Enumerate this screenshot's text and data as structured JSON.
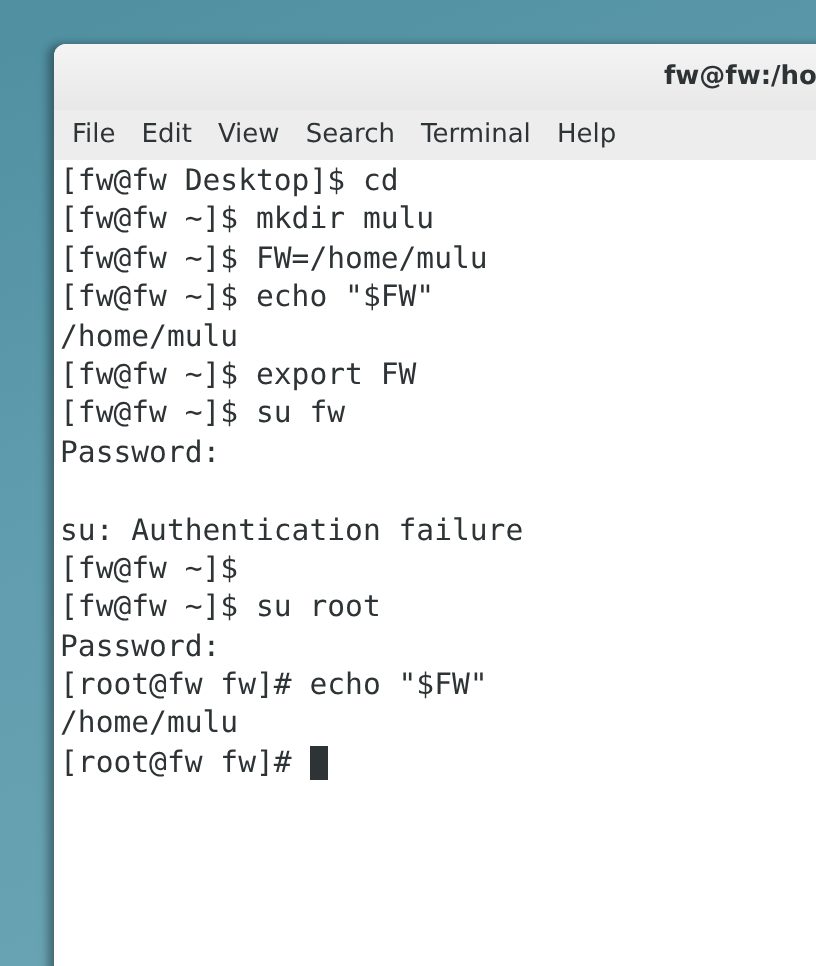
{
  "window": {
    "title": "fw@fw:/ho"
  },
  "menu": [
    "File",
    "Edit",
    "View",
    "Search",
    "Terminal",
    "Help"
  ],
  "terminal": {
    "lines": [
      {
        "kind": "text",
        "text": "[fw@fw Desktop]$ cd"
      },
      {
        "kind": "text",
        "text": "[fw@fw ~]$ mkdir mulu"
      },
      {
        "kind": "text",
        "text": "[fw@fw ~]$ FW=/home/mulu"
      },
      {
        "kind": "text",
        "text": "[fw@fw ~]$ echo \"$FW\""
      },
      {
        "kind": "text",
        "text": "/home/mulu"
      },
      {
        "kind": "text",
        "text": "[fw@fw ~]$ export FW"
      },
      {
        "kind": "text",
        "text": "[fw@fw ~]$ su fw"
      },
      {
        "kind": "text",
        "text": "Password:"
      },
      {
        "kind": "blank"
      },
      {
        "kind": "text",
        "text": "su: Authentication failure"
      },
      {
        "kind": "text",
        "text": "[fw@fw ~]$"
      },
      {
        "kind": "text",
        "text": "[fw@fw ~]$ su root"
      },
      {
        "kind": "text",
        "text": "Password:"
      },
      {
        "kind": "text",
        "text": "[root@fw fw]# echo \"$FW\""
      },
      {
        "kind": "text",
        "text": "/home/mulu"
      },
      {
        "kind": "prompt",
        "text": "[root@fw fw]#"
      }
    ]
  }
}
